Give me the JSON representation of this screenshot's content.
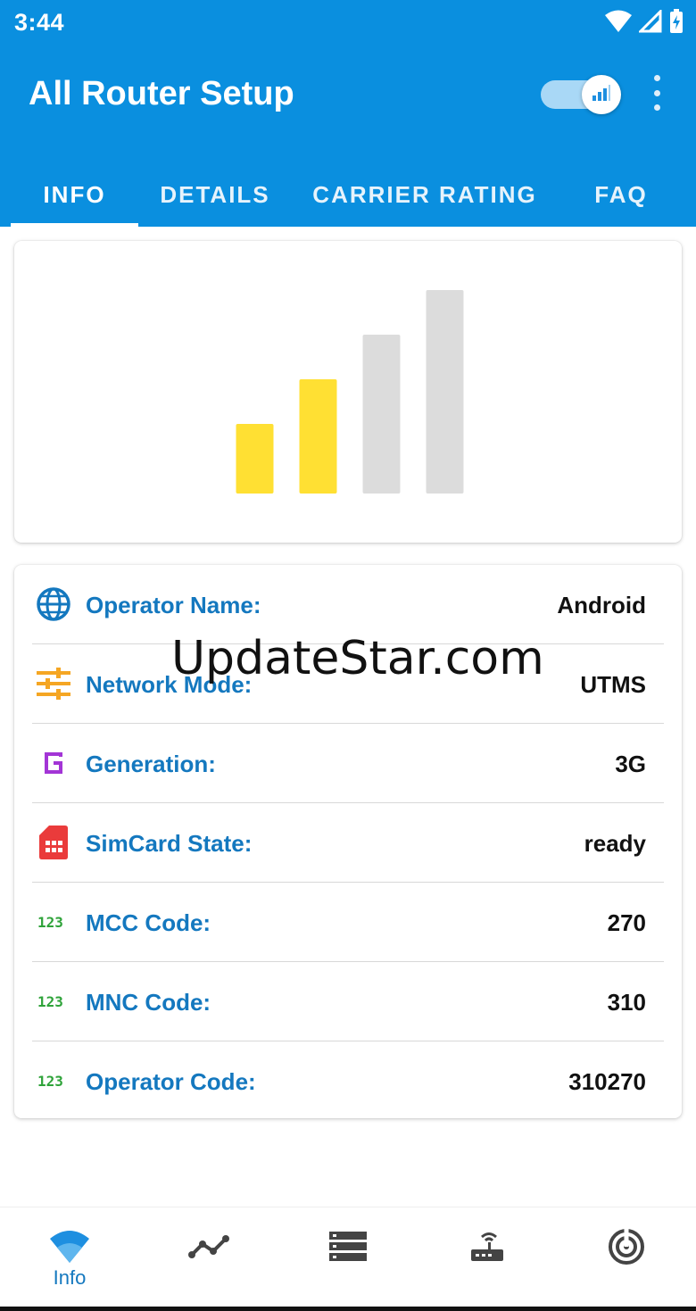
{
  "status_bar": {
    "time": "3:44",
    "icons": [
      "wifi-icon",
      "cell-signal-icon",
      "battery-charging-icon"
    ]
  },
  "app_bar": {
    "title": "All Router Setup",
    "toggle_on": true,
    "toggle_icon": "signal-bars-icon",
    "menu_icon": "more-vert-icon"
  },
  "tabs": [
    {
      "label": "INFO",
      "selected": true
    },
    {
      "label": "DETAILS",
      "selected": false
    },
    {
      "label": "CARRIER RATING",
      "selected": false
    },
    {
      "label": "FAQ",
      "selected": false
    }
  ],
  "signal_strength": {
    "total_bars": 4,
    "active_bars": 2,
    "active_color": "#ffe033",
    "inactive_color": "#dcdcdc"
  },
  "info_rows": [
    {
      "icon": "globe-icon",
      "label": "Operator Name:",
      "value": "Android",
      "icon_color": "#1478bf"
    },
    {
      "icon": "tune-sliders-icon",
      "label": "Network Mode:",
      "value": "UTMS",
      "icon_color": "#f5a623"
    },
    {
      "icon": "g-letter-icon",
      "label": "Generation:",
      "value": "3G",
      "icon_color": "#a335d6"
    },
    {
      "icon": "sim-card-icon",
      "label": "SimCard State:",
      "value": "ready",
      "icon_color": "#ea3b3b"
    },
    {
      "icon": "numbers-123-icon",
      "label": "MCC Code:",
      "value": "270",
      "icon_color": "#2fa33a"
    },
    {
      "icon": "numbers-123-icon",
      "label": "MNC Code:",
      "value": "310",
      "icon_color": "#2fa33a"
    },
    {
      "icon": "numbers-123-icon",
      "label": "Operator Code:",
      "value": "310270",
      "icon_color": "#2fa33a"
    }
  ],
  "watermark": "UpdateStar.com",
  "bottom_nav": [
    {
      "icon": "wifi-icon",
      "label": "Info",
      "selected": true
    },
    {
      "icon": "line-chart-icon",
      "label": "",
      "selected": false
    },
    {
      "icon": "server-list-icon",
      "label": "",
      "selected": false
    },
    {
      "icon": "router-icon",
      "label": "",
      "selected": false
    },
    {
      "icon": "radar-icon",
      "label": "",
      "selected": false
    }
  ],
  "colors": {
    "primary": "#0a8fdf",
    "accent_text": "#1478bf"
  }
}
